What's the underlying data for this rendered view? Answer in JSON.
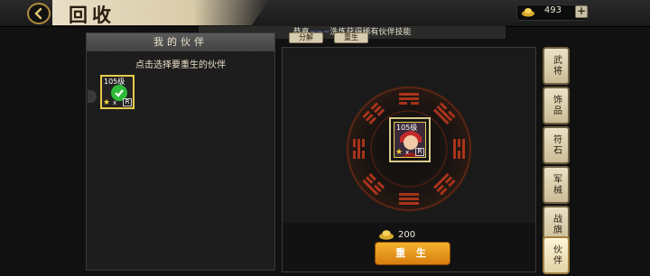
{
  "header": {
    "title": "回收",
    "gold": "493",
    "plus": "+"
  },
  "notice": {
    "prefix": "恭喜",
    "name": "~~~",
    "suffix": "洗炼获得稀有伙伴技能"
  },
  "left_panel": {
    "title": "我的伙伴",
    "hint": "点击选择要重生的伙伴",
    "card": {
      "level": "105级",
      "count": "x",
      "role": "R",
      "selected": true
    }
  },
  "main_panel": {
    "tabs": [
      "分解",
      "重生"
    ],
    "slot": {
      "level": "105级",
      "count": "x",
      "role": "R"
    },
    "cost": "200",
    "action_label": "重 生"
  },
  "side_tabs": [
    {
      "label": "武将",
      "active": false
    },
    {
      "label": "饰品",
      "active": false
    },
    {
      "label": "符石",
      "active": false
    },
    {
      "label": "军械",
      "active": false
    },
    {
      "label": "战旗",
      "active": false
    },
    {
      "label": "伙伴",
      "active": true
    }
  ],
  "colors": {
    "accent_gold": "#e6cc4a",
    "button_orange": "#f0a020",
    "bagua_red": "#a8331a",
    "check_green": "#2fbb3a"
  }
}
